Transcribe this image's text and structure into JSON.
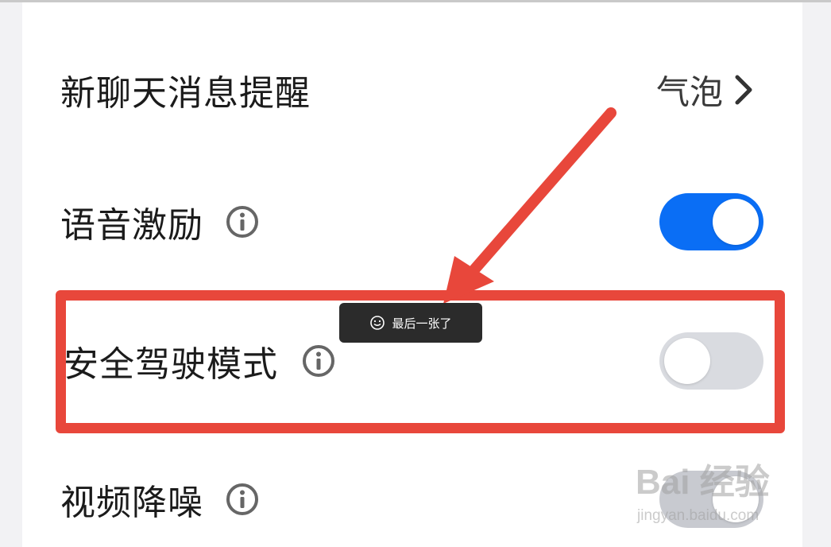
{
  "settings": {
    "rows": [
      {
        "label": "新聊天消息提醒",
        "value": "气泡"
      },
      {
        "label": "语音激励",
        "toggle_on": true
      },
      {
        "label": "安全驾驶模式",
        "toggle_on": false
      },
      {
        "label": "视频降噪",
        "toggle_on": true
      }
    ]
  },
  "toast": {
    "text": "最后一张了"
  },
  "watermark": {
    "logo_text": "Bai  经验",
    "url": "jingyan.baidu.com"
  },
  "colors": {
    "accent": "#0a6ef5",
    "annotation": "#e8473b",
    "toggle_off": "#d9dbe0"
  }
}
